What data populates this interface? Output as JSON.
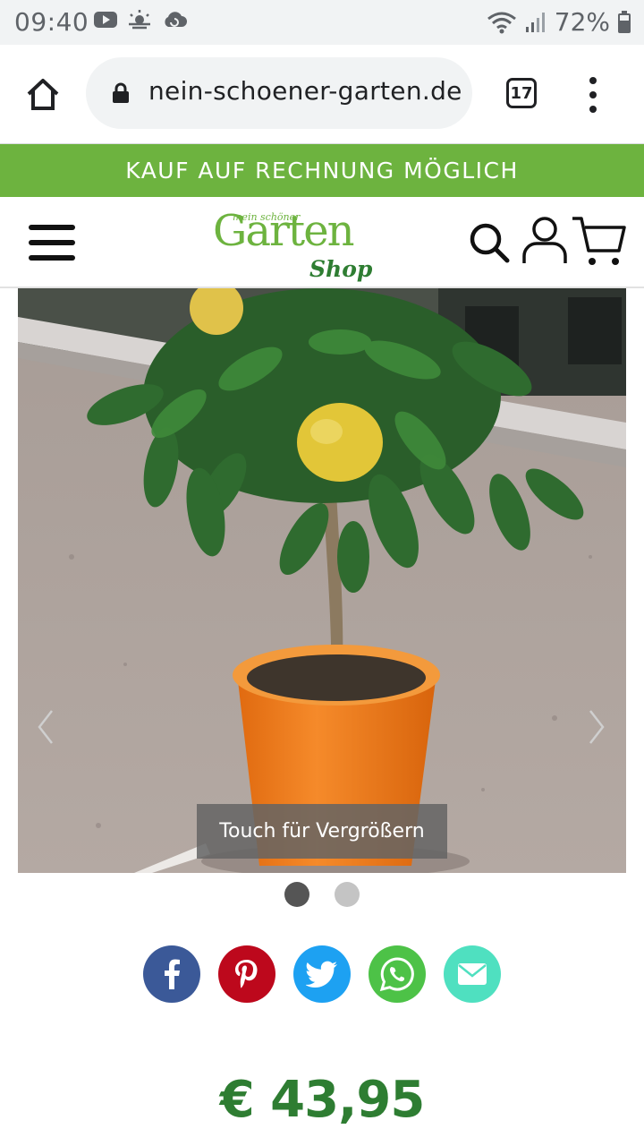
{
  "status_bar": {
    "time": "09:40",
    "battery": "72%",
    "icons": [
      "youtube-icon",
      "weather-icon",
      "cloud-sync-icon",
      "wifi-icon",
      "signal-icon",
      "battery-icon"
    ]
  },
  "browser": {
    "url": "nein-schoener-garten.de",
    "tab_count": "17",
    "icons": [
      "home-icon",
      "lock-icon",
      "more-vert-icon"
    ]
  },
  "promo": {
    "text": "KAUF AUF RECHNUNG MÖGLICH",
    "background": "#6db33f"
  },
  "site_header": {
    "logo": {
      "small": "mein schöner",
      "main": "Garten",
      "shop": "Shop"
    },
    "icons": [
      "hamburger-menu-icon",
      "search-icon",
      "user-icon",
      "cart-icon"
    ]
  },
  "product": {
    "image_hint": "Touch für Vergrößern",
    "gallery_active_index": 0,
    "gallery_count": 2,
    "price": "€ 43,95",
    "price_color": "#2e7d32"
  },
  "share": [
    {
      "name": "facebook",
      "color": "#3b5998"
    },
    {
      "name": "pinterest",
      "color": "#bd081c"
    },
    {
      "name": "twitter",
      "color": "#1da1f2"
    },
    {
      "name": "whatsapp",
      "color": "#4dc247"
    },
    {
      "name": "email",
      "color": "#4fe0c0"
    }
  ]
}
